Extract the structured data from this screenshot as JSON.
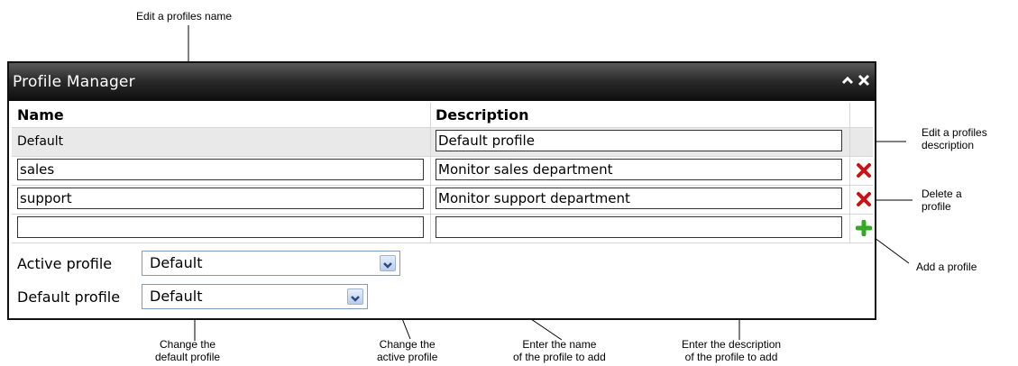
{
  "callouts": {
    "edit_name": "Edit a profiles name",
    "edit_description": "Edit a profiles\ndescription",
    "delete_profile": "Delete a\nprofile",
    "add_profile": "Add a profile",
    "change_default": "Change the\ndefault profile",
    "change_active": "Change the\nactive profile",
    "enter_name": "Enter the name\nof the profile to add",
    "enter_description": "Enter the description\nof the profile to add"
  },
  "window": {
    "title": "Profile Manager",
    "collapse_icon": "chevron-up-icon",
    "close_icon": "close-icon"
  },
  "table": {
    "headers": {
      "name": "Name",
      "description": "Description"
    },
    "rows": [
      {
        "name": "Default",
        "description": "Default profile",
        "name_editable": false,
        "action": ""
      },
      {
        "name": "sales",
        "description": "Monitor sales department",
        "name_editable": true,
        "action": "delete-icon"
      },
      {
        "name": "support",
        "description": "Monitor support department",
        "name_editable": true,
        "action": "delete-icon"
      }
    ],
    "new_row": {
      "name": "",
      "description": "",
      "action": "add-icon"
    }
  },
  "active_profile": {
    "label": "Active profile",
    "value": "Default"
  },
  "default_profile": {
    "label": "Default profile",
    "value": "Default"
  },
  "colors": {
    "titlebar": "#1a1a1a",
    "row_highlight": "#e9e9e9",
    "delete": "#cc1111",
    "add": "#33aa22",
    "select_border": "#7f9db9"
  }
}
